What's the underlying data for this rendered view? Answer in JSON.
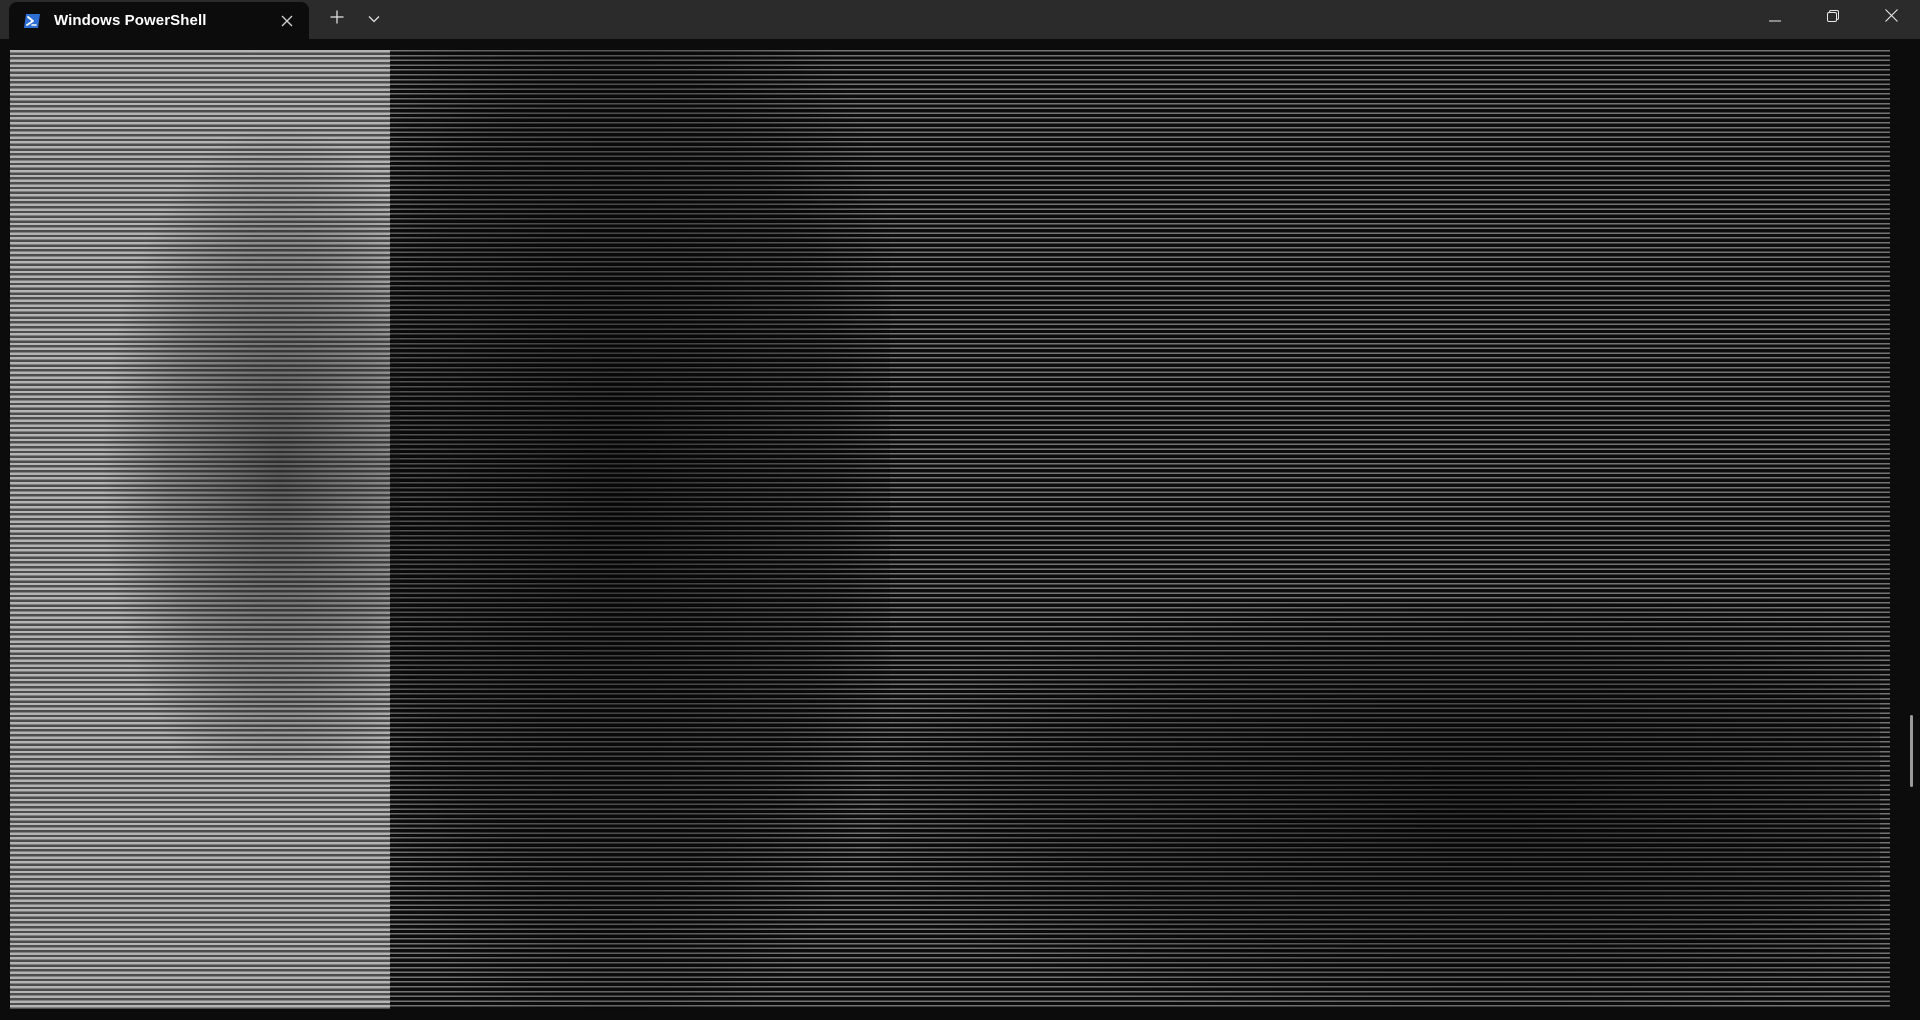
{
  "titlebar": {
    "tab": {
      "title": "Windows PowerShell",
      "icon": "powershell-icon",
      "close_icon": "close-icon"
    },
    "new_tab_icon": "plus-icon",
    "dropdown_icon": "chevron-down-icon",
    "caption_buttons": {
      "minimize_icon": "minimize-icon",
      "restore_icon": "restore-icon",
      "close_icon": "close-icon"
    }
  },
  "terminal": {
    "content_type": "ascii-art"
  },
  "colors": {
    "titlebar_bg": "#2b2b2b",
    "terminal_bg": "#0c0c0c",
    "tab_text": "#ffffff",
    "powershell_blue": "#2e6fd6"
  }
}
